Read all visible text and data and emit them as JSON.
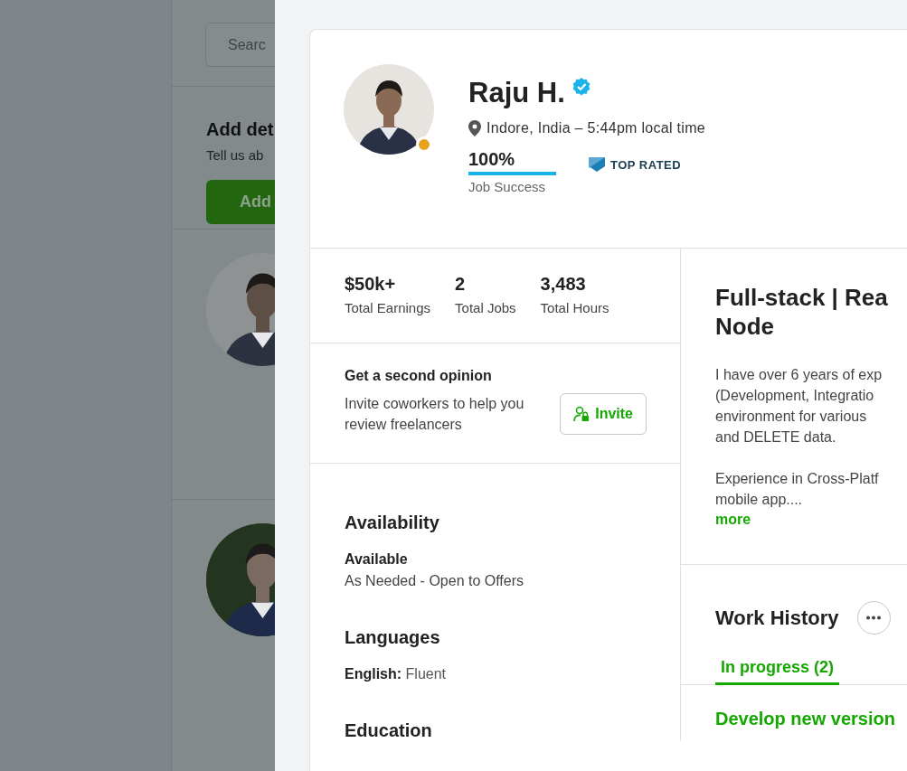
{
  "background_page": {
    "search": {
      "placeholder": "Searc"
    },
    "prompt": {
      "title": "Add det",
      "text": "Tell us ab",
      "button": "Add"
    }
  },
  "profile": {
    "name": "Raju H.",
    "verified": true,
    "away": true,
    "location": "Indore, India – 5:44pm local time",
    "job_success": {
      "value": "100%",
      "level": 1,
      "label": "Job Success"
    },
    "badge": "TOP RATED"
  },
  "stats": [
    {
      "value": "$50k+",
      "label": "Total Earnings"
    },
    {
      "value": "2",
      "label": "Total Jobs"
    },
    {
      "value": "3,483",
      "label": "Total Hours"
    }
  ],
  "second_opinion": {
    "title": "Get a second opinion",
    "text": "Invite coworkers to help you review freelancers",
    "button": "Invite"
  },
  "availability": {
    "heading": "Availability",
    "status": "Available",
    "detail": "As Needed - Open to Offers"
  },
  "languages": {
    "heading": "Languages",
    "items": [
      {
        "name": "English:",
        "proficiency": "Fluent"
      }
    ]
  },
  "education": {
    "heading": "Education"
  },
  "overview": {
    "title_lines": [
      "Full-stack | Rea",
      "Node"
    ],
    "paragraphs": [
      [
        "I have over 6 years of exp",
        "(Development, Integratio",
        "environment for various",
        "and DELETE data."
      ],
      [
        "Experience in Cross-Platf",
        "mobile app...."
      ]
    ],
    "more": "more"
  },
  "work_history": {
    "heading": "Work History",
    "tabs": [
      {
        "label": "In progress (2)",
        "selected": true
      }
    ],
    "jobs": [
      {
        "title": "Develop new version"
      }
    ]
  }
}
